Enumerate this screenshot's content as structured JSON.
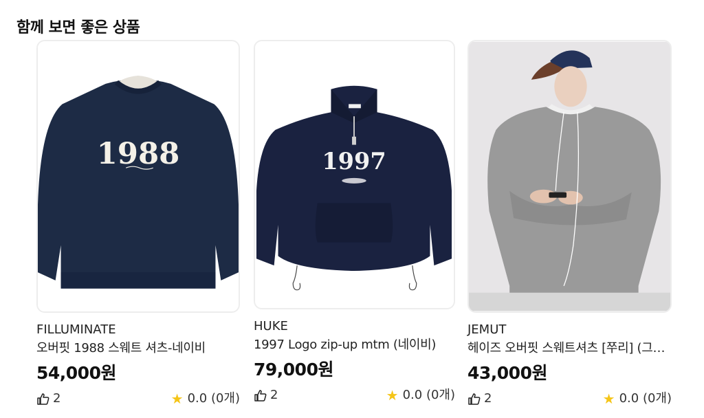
{
  "section": {
    "title": "함께 보면 좋은 상품"
  },
  "products": [
    {
      "brand": "FILLUMINATE",
      "name": "오버핏 1988 스웨트 셔츠-네이비",
      "price": "54,000원",
      "likes": "2",
      "rating": "0.0 (0개)",
      "print": "1988",
      "colors": {
        "garment": "#1d2b45",
        "print": "#f4f1e8"
      }
    },
    {
      "brand": "HUKE",
      "name": "1997 Logo zip-up mtm (네이비)",
      "price": "79,000원",
      "likes": "2",
      "rating": "0.0 (0개)",
      "print": "1997",
      "colors": {
        "garment": "#1a2240",
        "print": "#f1f1f1"
      }
    },
    {
      "brand": "JEMUT",
      "name": "헤이즈 오버핏 스웨트셔츠 [쭈리] (그레이)",
      "price": "43,000원",
      "likes": "2",
      "rating": "0.0 (0개)",
      "colors": {
        "garment": "#9a9a9a",
        "background": "#e7e5e7"
      }
    }
  ],
  "icons": {
    "like": "thumbs-up-icon",
    "star": "star-icon"
  }
}
